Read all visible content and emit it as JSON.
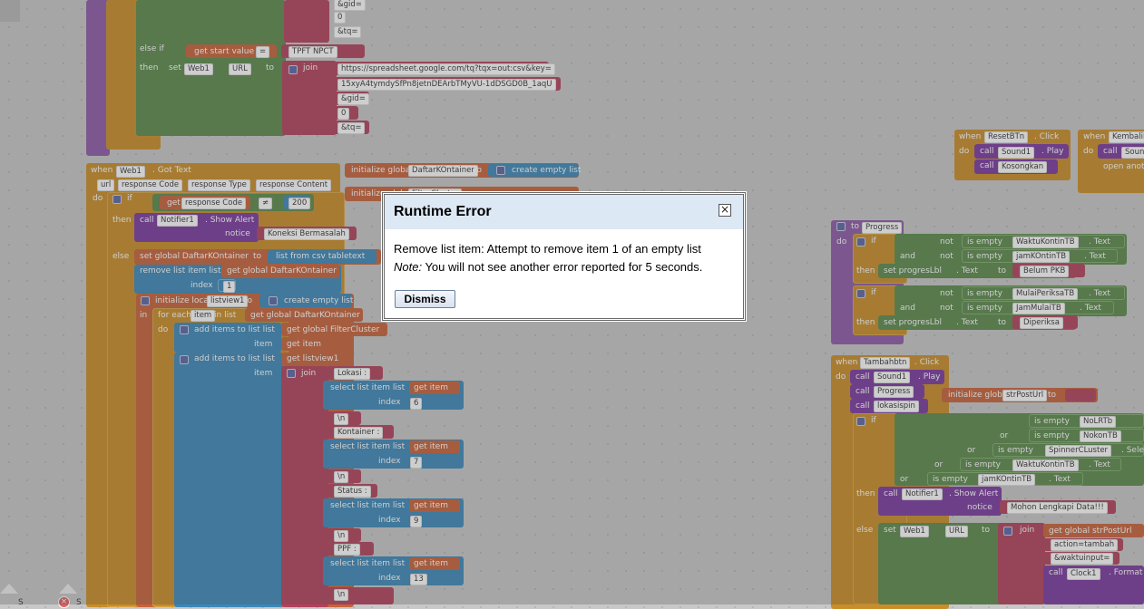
{
  "dialog": {
    "title": "Runtime Error",
    "close": "×",
    "message": "Remove list item: Attempt to remove item 1 of an empty list",
    "note_label": "Note:",
    "note_text": " You will not see another error reported for 5 seconds.",
    "dismiss": "Dismiss"
  },
  "top_block": {
    "else_if": "else if",
    "then": "then",
    "get_start": "get start value",
    "eq": "=",
    "tpft": "TPFT NPCT",
    "set": "set",
    "web1": "Web1",
    "url": "URL",
    "to": "to",
    "join": "join",
    "s1": "https://spreadsheet.google.com/tq?tqx=out:csv&key=",
    "s2": "15xyA4tymdySfPn8jetnDEArbTMyVU-1dDSGD0B_1aqU",
    "s3": "&gid=",
    "s4": "0",
    "s5": "&tq=",
    "top_gid": "&gid=",
    "top_zero": "0",
    "top_tq": "&tq="
  },
  "gottext": {
    "when": "when",
    "web1": "Web1",
    "event": ". Got Text",
    "params": [
      "url",
      "response Code",
      "response Type",
      "response Content"
    ],
    "do": "do",
    "if": "if",
    "get": "get",
    "resp_code": "response Code",
    "neq": "≠",
    "num200": "200",
    "then": "then",
    "call": "call",
    "notifier": "Notifier1",
    "show_alert": ". Show Alert",
    "notice": "notice",
    "koneksi": "Koneksi Bermasalah",
    "else": "else",
    "set_global": "set global DaftarKOntainer",
    "to": "to",
    "list_from_csv": "list from csv tabletext",
    "remove_list_item": "remove list item   list",
    "get_global_daftar": "get global DaftarKOntainer",
    "index": "index",
    "one": "1",
    "init_local": "initialize local",
    "listview1": "listview1",
    "create_empty": "create empty list",
    "in": "in",
    "for_each": "for each",
    "item": "item",
    "in_list": "in list",
    "add_items": "add items to list  list",
    "get_filter": "get global FilterCluster",
    "get_item": "get item",
    "get_listview": "get listview1",
    "join": "join",
    "lokasi": "Lokasi :",
    "select_list_item": "select list item   list",
    "nl": "\\n",
    "kontainer": "Kontainer :",
    "status": "Status :",
    "ppf": "PPF :",
    "idx6": "6",
    "idx7": "7",
    "idx9": "9",
    "idx13": "13"
  },
  "globals": {
    "init_global": "initialize global",
    "daftar": "DaftarKOntainer",
    "to": "to",
    "create_empty": "create empty list",
    "filter": "FilterCluster"
  },
  "reset": {
    "when": "when",
    "btn": "ResetBTn",
    "click": ". Click",
    "do": "do",
    "call": "call",
    "sound": "Sound1",
    "play": ". Play",
    "kosongkan": "Kosongkan",
    "kembali": "KembaliB",
    "sound_trunc": "Soun",
    "open_another": "open anoth"
  },
  "progress": {
    "to": "to",
    "name": "Progress",
    "do": "do",
    "if": "if",
    "not": "not",
    "is_empty": "is empty",
    "and": "and",
    "waktu": "WaktuKontinTB",
    "jamk": "jamKOntinTB",
    "text": ". Text",
    "then": "then",
    "set_prog": "set progresLbl",
    "to2": "to",
    "belum": "Belum PKB",
    "mulai": "MulaiPeriksaTB",
    "jammulai": "JamMulaiTB",
    "diperiksa": "Diperiksa"
  },
  "tambah": {
    "when": "when",
    "btn": "Tambahbtn",
    "click": ". Click",
    "do": "do",
    "call": "call",
    "sound": "Sound1",
    "play": ". Play",
    "progress": "Progress",
    "lokasispin": "lokasispin",
    "init_global": "initialize global",
    "strpost": "strPostUrl",
    "to": "to",
    "if": "if",
    "is_empty": "is empty",
    "or": "or",
    "nolr": "NoLRTb",
    "nokon": "NokonTB",
    "spinner": "SpinnerCLuster",
    "waktu": "WaktuKontinTB",
    "jamk": "jamKOntinTB",
    "text": ". Text",
    "sele": ". Sele",
    "te": ". Te",
    "then": "then",
    "notifier": "Notifier1",
    "show_alert": ". Show Alert",
    "notice": "notice",
    "mohon": "Mohon Lengkapi Data!!!",
    "else": "else",
    "set": "set",
    "web1": "Web1",
    "url": "URL",
    "join": "join",
    "get_global": "get global strPostUrl",
    "action": "action=tambah",
    "waktuinput": "&waktuinput=",
    "clock": "Clock1",
    "format": ". Format"
  },
  "bottom": {
    "ctl1": "S",
    "ctl2": "S"
  }
}
